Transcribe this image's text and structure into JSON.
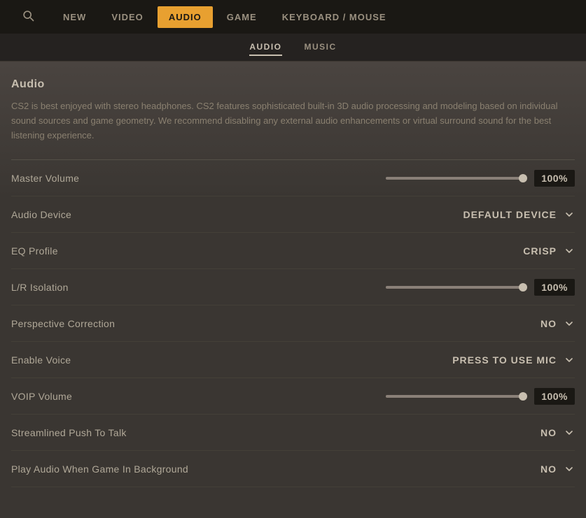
{
  "topNav": {
    "items": [
      {
        "id": "new",
        "label": "NEW",
        "active": false
      },
      {
        "id": "video",
        "label": "VIDEO",
        "active": false
      },
      {
        "id": "audio",
        "label": "AUDIO",
        "active": true
      },
      {
        "id": "game",
        "label": "GAME",
        "active": false
      },
      {
        "id": "keyboard-mouse",
        "label": "KEYBOARD / MOUSE",
        "active": false
      }
    ]
  },
  "subNav": {
    "items": [
      {
        "id": "audio",
        "label": "AUDIO",
        "active": true
      },
      {
        "id": "music",
        "label": "MUSIC",
        "active": false
      }
    ]
  },
  "content": {
    "sectionTitle": "Audio",
    "description": "CS2 is best enjoyed with stereo headphones. CS2 features sophisticated built-in 3D audio processing and modeling based on individual sound sources and game geometry. We recommend disabling any external audio enhancements or virtual surround sound for the best listening experience.",
    "settings": [
      {
        "id": "master-volume",
        "label": "Master Volume",
        "type": "slider",
        "value": "100%",
        "fillPercent": 100
      },
      {
        "id": "audio-device",
        "label": "Audio Device",
        "type": "dropdown",
        "value": "DEFAULT DEVICE"
      },
      {
        "id": "eq-profile",
        "label": "EQ Profile",
        "type": "dropdown",
        "value": "CRISP"
      },
      {
        "id": "lr-isolation",
        "label": "L/R Isolation",
        "type": "slider",
        "value": "100%",
        "fillPercent": 100
      },
      {
        "id": "perspective-correction",
        "label": "Perspective Correction",
        "type": "dropdown",
        "value": "NO"
      },
      {
        "id": "enable-voice",
        "label": "Enable Voice",
        "type": "dropdown",
        "value": "PRESS TO USE MIC"
      },
      {
        "id": "voip-volume",
        "label": "VOIP Volume",
        "type": "slider",
        "value": "100%",
        "fillPercent": 100
      },
      {
        "id": "streamlined-push-to-talk",
        "label": "Streamlined Push To Talk",
        "type": "dropdown",
        "value": "NO"
      },
      {
        "id": "play-audio-background",
        "label": "Play Audio When Game In Background",
        "type": "dropdown",
        "value": "NO"
      }
    ]
  }
}
